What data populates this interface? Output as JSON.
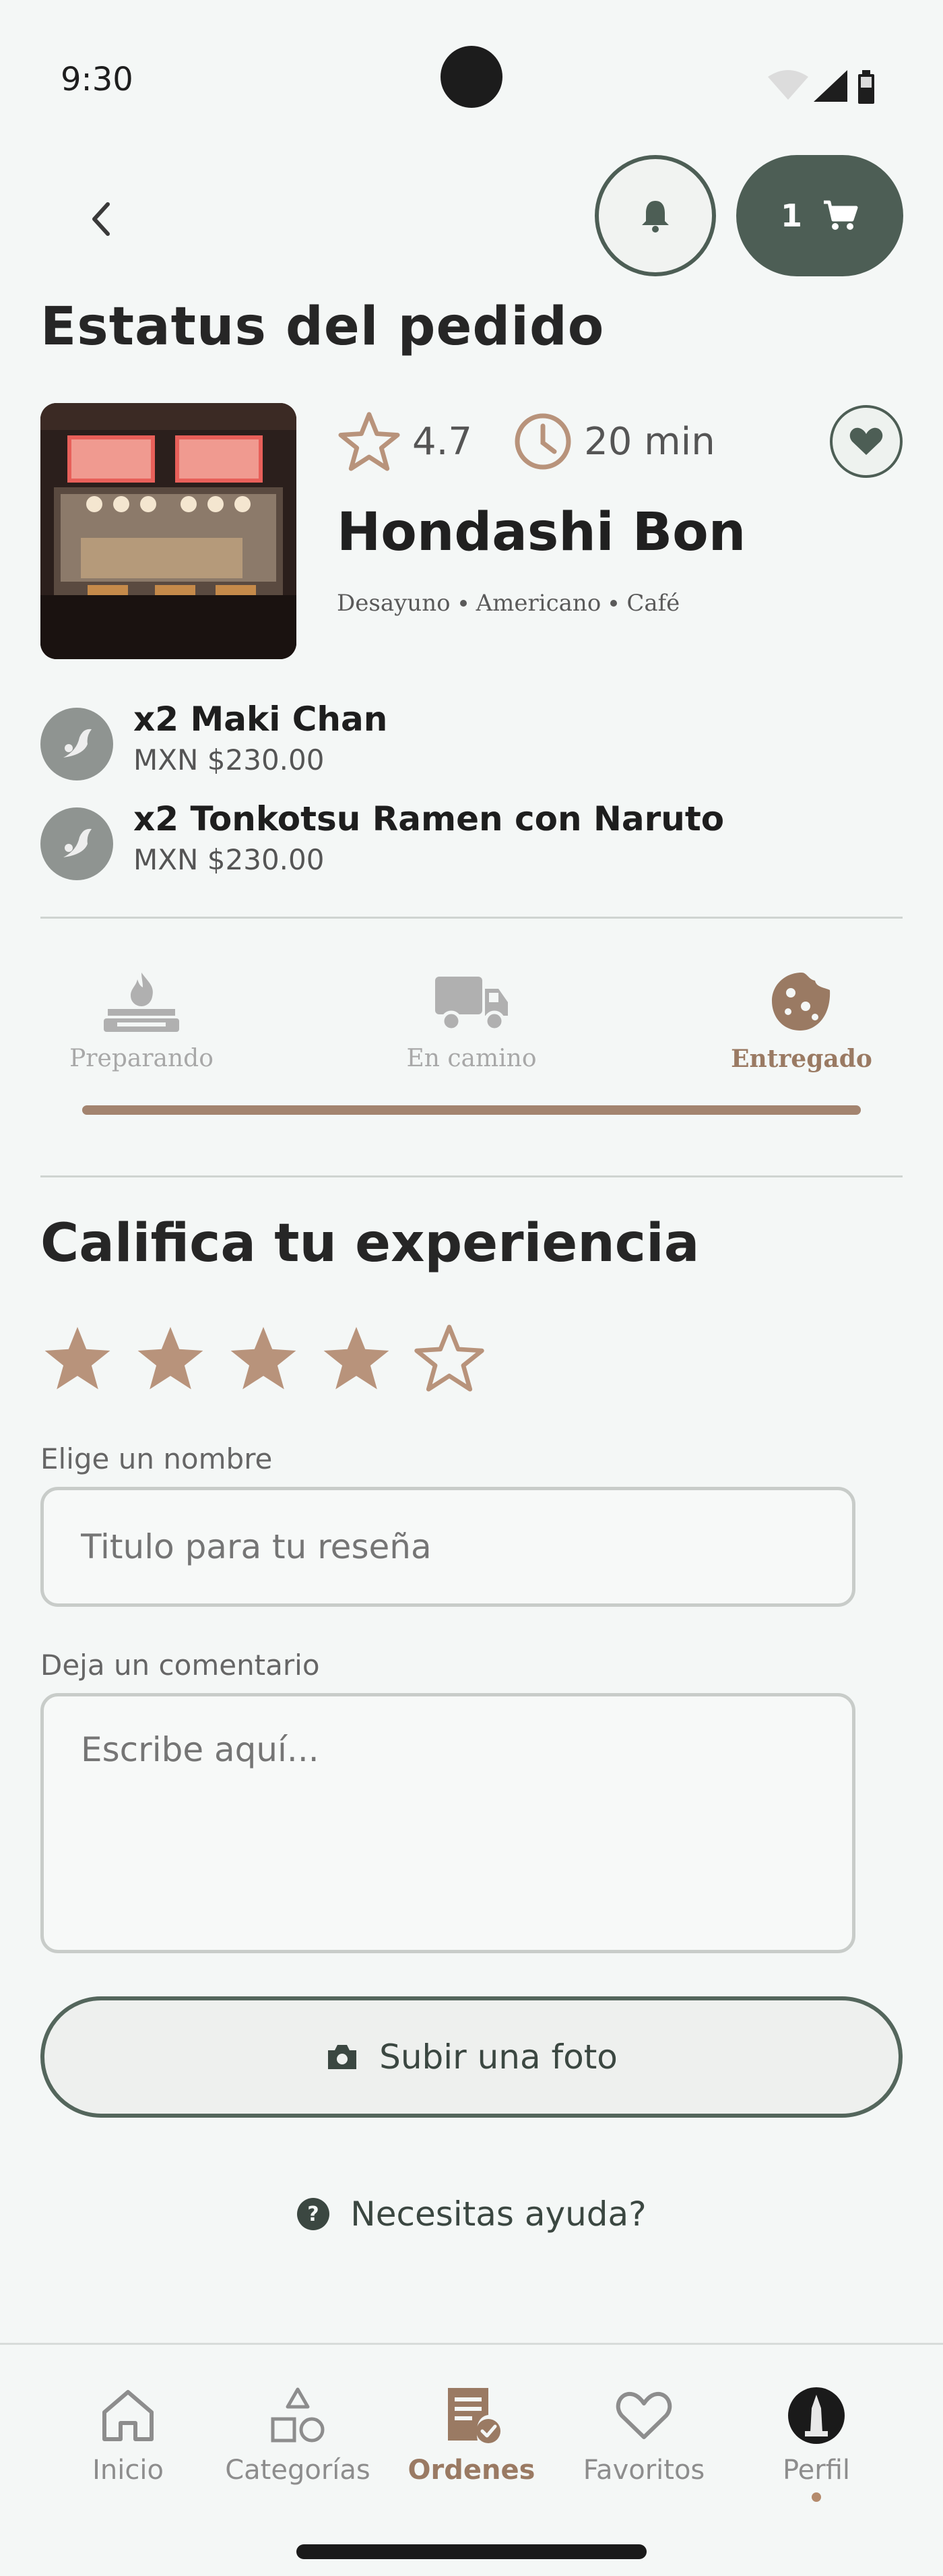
{
  "status_bar": {
    "time": "9:30"
  },
  "header": {
    "cart_count": "1"
  },
  "page": {
    "title": "Estatus del pedido"
  },
  "restaurant": {
    "rating": "4.7",
    "eta": "20 min",
    "name": "Hondashi Bon",
    "tags": [
      "Desayuno",
      "Americano",
      "Café"
    ]
  },
  "order_items": [
    {
      "name": "x2 Maki Chan",
      "price": "MXN  $230.00"
    },
    {
      "name": "x2 Tonkotsu Ramen con Naruto",
      "price": "MXN  $230.00"
    }
  ],
  "tracker": {
    "steps": [
      {
        "label": "Preparando",
        "icon": "stove-fire-icon"
      },
      {
        "label": "En camino",
        "icon": "delivery-truck-icon"
      },
      {
        "label": "Entregado",
        "icon": "cookie-icon"
      }
    ],
    "active_step": 2,
    "progress": 1.0
  },
  "review": {
    "title": "Califica tu experiencia",
    "rating": 4,
    "max_rating": 5,
    "name_label": "Elige un nombre",
    "name_placeholder": "Titulo para tu reseña",
    "comment_label": "Deja un comentario",
    "comment_placeholder": "Escribe aquí...",
    "upload_label": "Subir una foto"
  },
  "help": {
    "label": "Necesitas ayuda?"
  },
  "bottom_nav": [
    {
      "label": "Inicio",
      "icon": "home-icon"
    },
    {
      "label": "Categorías",
      "icon": "shapes-icon"
    },
    {
      "label": "Ordenes",
      "icon": "receipt-check-icon",
      "active": true
    },
    {
      "label": "Favoritos",
      "icon": "heart-icon"
    },
    {
      "label": "Perfil",
      "icon": "avatar-icon"
    }
  ],
  "colors": {
    "primary": "#4d5e55",
    "accent": "#9a7a63",
    "star": "#b8937b",
    "background": "#f4f7f6"
  }
}
